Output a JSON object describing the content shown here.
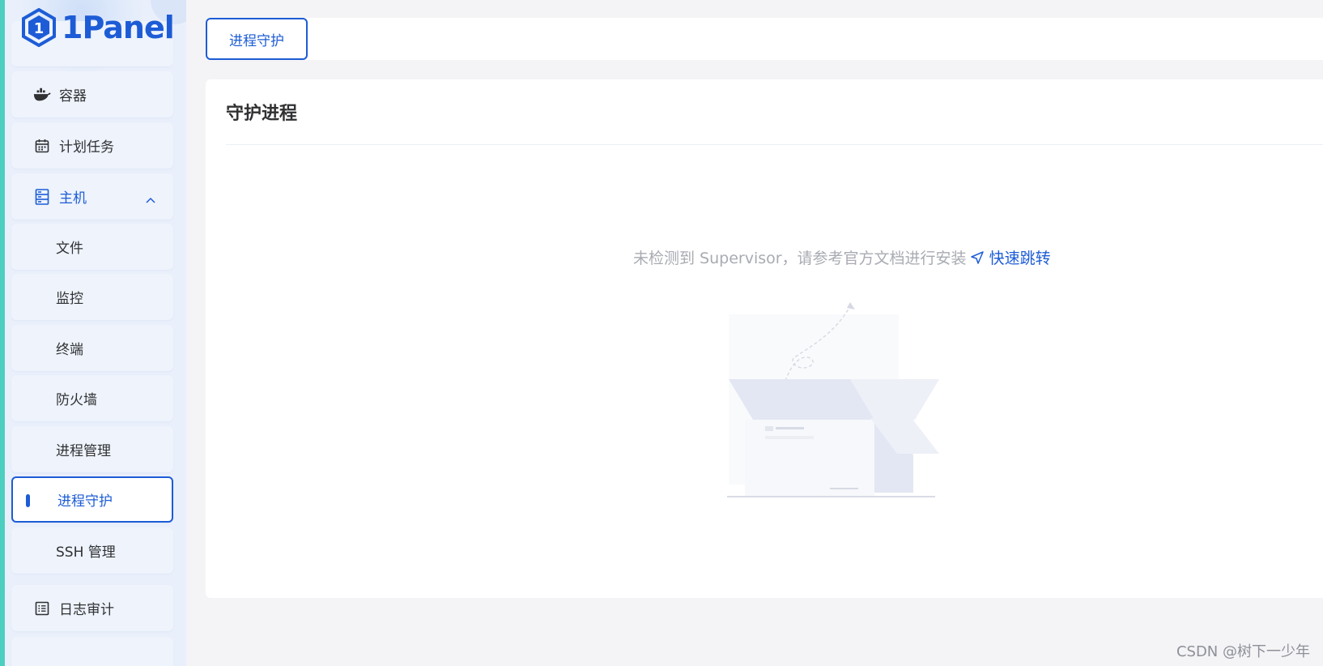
{
  "app": {
    "logo_text": "1Panel"
  },
  "sidebar": {
    "items": [
      {
        "label": "容器",
        "icon": "docker-icon"
      },
      {
        "label": "计划任务",
        "icon": "calendar-icon"
      },
      {
        "label": "主机",
        "icon": "server-icon",
        "expanded": true
      },
      {
        "label": "文件"
      },
      {
        "label": "监控"
      },
      {
        "label": "终端"
      },
      {
        "label": "防火墙"
      },
      {
        "label": "进程管理"
      },
      {
        "label": "进程守护",
        "active": true
      },
      {
        "label": "SSH 管理"
      },
      {
        "label": "日志审计",
        "icon": "list-icon"
      }
    ]
  },
  "tabs": {
    "active_label": "进程守护"
  },
  "main": {
    "title": "守护进程",
    "notice_text": "未检测到 Supervisor，请参考官方文档进行安装",
    "link_text": "快速跳转"
  },
  "watermark": "CSDN @树下一少年",
  "colors": {
    "accent": "#1d5cd6",
    "sidebar_bg": "#eaf0fb",
    "strip": "#4dcfc0"
  }
}
